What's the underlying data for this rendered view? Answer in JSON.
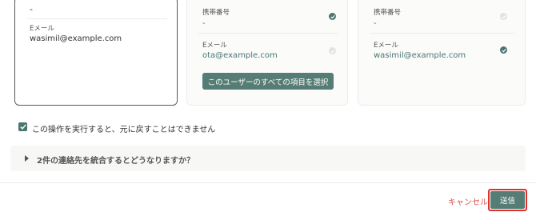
{
  "left_card": {
    "top_value": "-",
    "email_label": "Eメール",
    "email_value": "wasimil@example.com"
  },
  "mid_card": {
    "phone_label": "携帯番号",
    "phone_value": "-",
    "phone_selected": true,
    "email_label": "Eメール",
    "email_value": "ota@example.com",
    "email_selected": false,
    "select_all_button": "このユーザーのすべての項目を選択"
  },
  "right_card": {
    "phone_label": "携帯番号",
    "phone_value": "-",
    "phone_selected": false,
    "email_label": "Eメール",
    "email_value": "wasimil@example.com",
    "email_selected": true
  },
  "confirm": {
    "checked": true,
    "label": "この操作を実行すると、元に戻すことはできません"
  },
  "accordion": {
    "label": "2件の連絡先を統合するとどうなりますか？"
  },
  "footer": {
    "cancel_label": "キャンセル",
    "submit_label": "送信"
  },
  "colors": {
    "accent": "#557d75",
    "danger": "#d9534f",
    "highlight": "#e0302e"
  }
}
